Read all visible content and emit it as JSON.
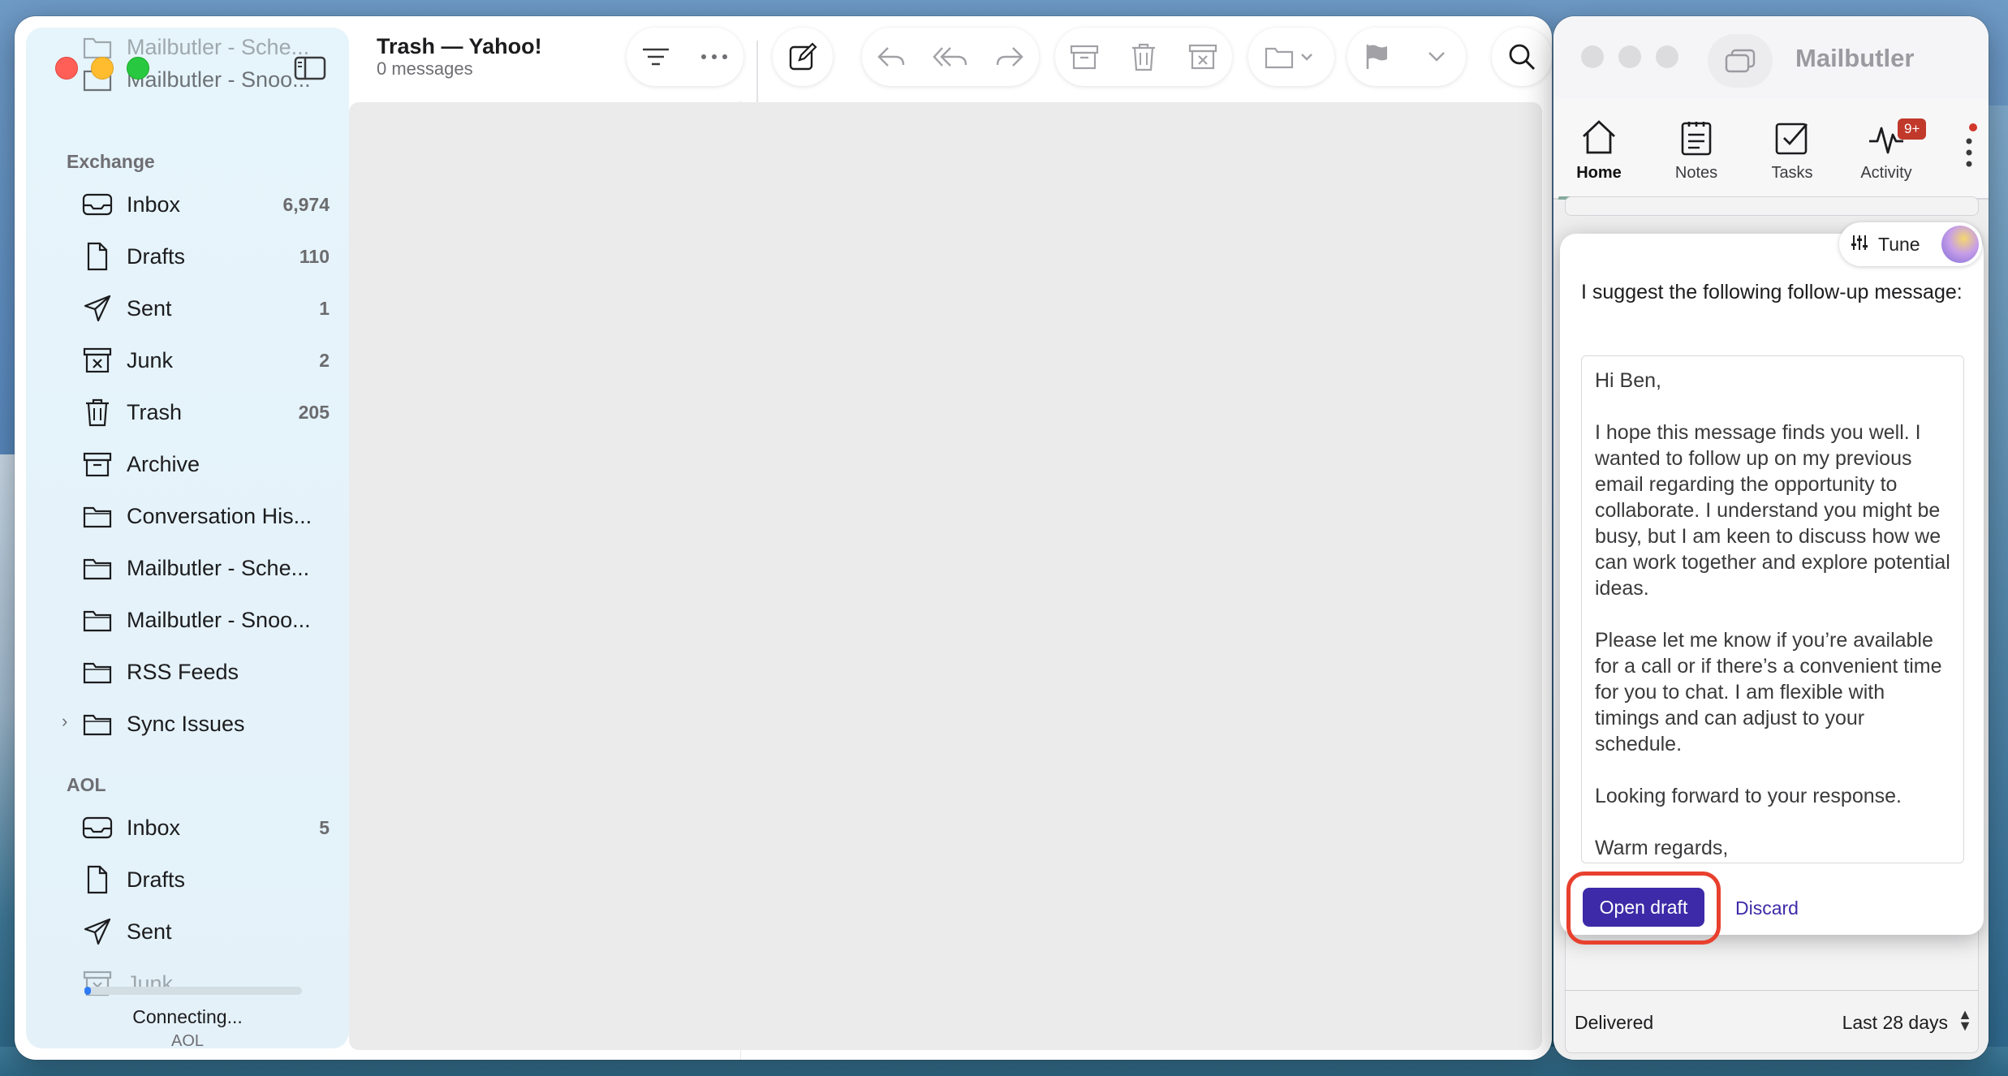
{
  "mail": {
    "window_title": "Trash — Yahoo!",
    "window_subtitle": "0 messages",
    "sidebar": {
      "top_faded_items": [
        "Mailbutler - Sche...",
        "Mailbutler - Snoo..."
      ],
      "exchange_label": "Exchange",
      "exchange_items": [
        {
          "label": "Inbox",
          "count": "6,974",
          "icon": "inbox-icon"
        },
        {
          "label": "Drafts",
          "count": "110",
          "icon": "document-icon"
        },
        {
          "label": "Sent",
          "count": "1",
          "icon": "paper-plane-icon"
        },
        {
          "label": "Junk",
          "count": "2",
          "icon": "junk-icon"
        },
        {
          "label": "Trash",
          "count": "205",
          "icon": "trash-icon"
        },
        {
          "label": "Archive",
          "count": "",
          "icon": "archive-icon"
        },
        {
          "label": "Conversation His...",
          "count": "",
          "icon": "folder-icon"
        },
        {
          "label": "Mailbutler - Sche...",
          "count": "",
          "icon": "folder-icon"
        },
        {
          "label": "Mailbutler - Snoo...",
          "count": "",
          "icon": "folder-icon"
        },
        {
          "label": "RSS Feeds",
          "count": "",
          "icon": "folder-icon"
        },
        {
          "label": "Sync Issues",
          "count": "",
          "icon": "folder-icon"
        }
      ],
      "aol_label": "AOL",
      "aol_items": [
        {
          "label": "Inbox",
          "count": "5",
          "icon": "inbox-icon"
        },
        {
          "label": "Drafts",
          "count": "",
          "icon": "document-icon"
        },
        {
          "label": "Sent",
          "count": "",
          "icon": "paper-plane-icon"
        },
        {
          "label": "Junk",
          "count": "",
          "icon": "junk-icon"
        }
      ],
      "status_text": "Connecting...",
      "status_account": "AOL",
      "progress": 0.03
    }
  },
  "mailbutler": {
    "title": "Mailbutler",
    "tabs": [
      {
        "label": "Home",
        "icon": "home-icon",
        "active": true
      },
      {
        "label": "Notes",
        "icon": "notes-icon"
      },
      {
        "label": "Tasks",
        "icon": "tasks-icon"
      },
      {
        "label": "Activity",
        "icon": "activity-icon",
        "badge": "9+"
      }
    ],
    "tune_label": "Tune",
    "suggestion_intro": "I suggest the following follow-up message:",
    "draft_text": "Hi Ben,\n\nI hope this message finds you well. I wanted to follow up on my previous email regarding the opportunity to collaborate. I understand you might be busy, but I am keen to discuss how we can work together and explore potential ideas.\n\nPlease let me know if you’re available for a call or if there’s a convenient time for you to chat. I am flexible with timings and can adjust to your schedule.\n\nLooking forward to your response.\n\nWarm regards,",
    "open_draft_label": "Open draft",
    "discard_label": "Discard",
    "footer_status": "Delivered",
    "footer_range": "Last 28 days",
    "colors": {
      "primary": "#3d2aa8",
      "highlight": "#e8402e",
      "badge": "#c0392b"
    }
  }
}
